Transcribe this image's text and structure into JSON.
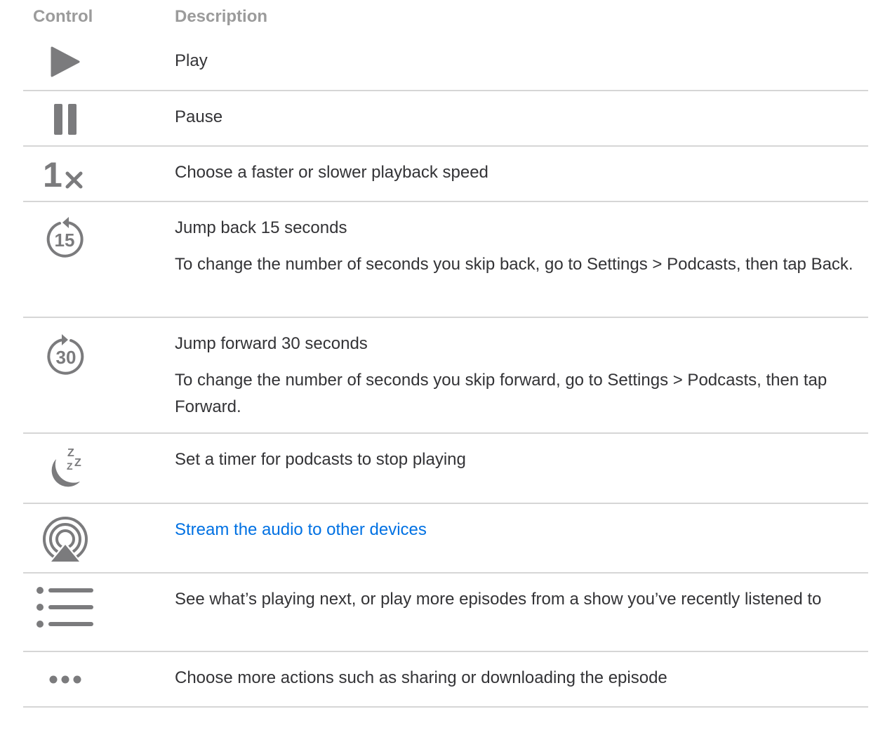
{
  "header": {
    "control": "Control",
    "description": "Description"
  },
  "rows": [
    {
      "icon": "play-icon",
      "text": "Play"
    },
    {
      "icon": "pause-icon",
      "text": "Pause"
    },
    {
      "icon": "playback-speed-icon",
      "speed_label": "1",
      "text": "Choose a faster or slower playback speed"
    },
    {
      "icon": "skip-back-15-icon",
      "number": "15",
      "text": "Jump back 15 seconds",
      "detail": "To change the number of seconds you skip back, go to Settings > Podcasts, then tap Back."
    },
    {
      "icon": "skip-forward-30-icon",
      "number": "30",
      "text": "Jump forward 30 seconds",
      "detail": "To change the number of seconds you skip forward, go to Settings > Podcasts, then tap Forward."
    },
    {
      "icon": "sleep-timer-icon",
      "text": "Set a timer for podcasts to stop playing"
    },
    {
      "icon": "airplay-icon",
      "text": "Stream the audio to other devices"
    },
    {
      "icon": "up-next-list-icon",
      "text": "See what’s playing next, or play more episodes from a show you’ve recently listened to"
    },
    {
      "icon": "more-icon",
      "text": "Choose more actions such as sharing or downloading the episode"
    }
  ],
  "colors": {
    "icon": "#7b7b7d",
    "text": "#333336",
    "header": "#9b9b9b",
    "link": "#0071e3",
    "divider": "#d6d6d6"
  }
}
